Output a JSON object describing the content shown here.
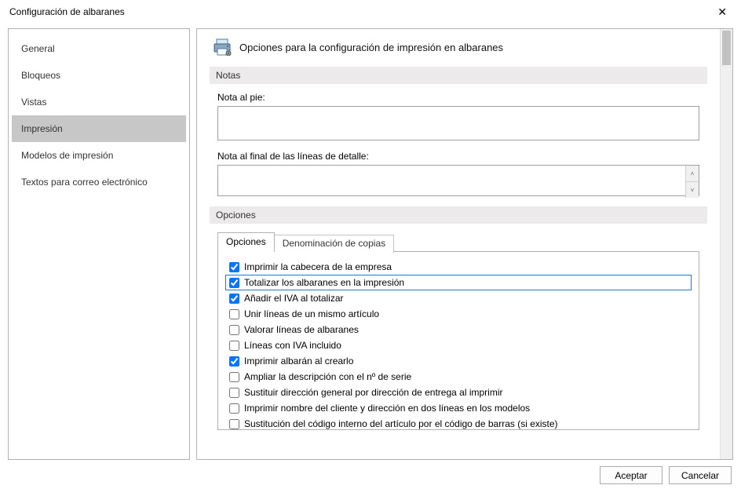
{
  "window": {
    "title": "Configuración de albaranes"
  },
  "sidebar": {
    "items": [
      {
        "label": "General"
      },
      {
        "label": "Bloqueos"
      },
      {
        "label": "Vistas"
      },
      {
        "label": "Impresión",
        "selected": true
      },
      {
        "label": "Modelos de impresión"
      },
      {
        "label": "Textos para correo electrónico"
      }
    ]
  },
  "page": {
    "heading": "Opciones para la configuración de impresión en albaranes",
    "section_notas": "Notas",
    "nota_pie_label": "Nota al pie:",
    "nota_pie_value": "",
    "nota_detalle_label": "Nota al final de las líneas de detalle:",
    "nota_detalle_value": "",
    "section_opciones": "Opciones",
    "tabs": {
      "active": "Opciones",
      "inactive": "Denominación de copias"
    },
    "checks": [
      {
        "label": "Imprimir la cabecera de la empresa",
        "checked": true,
        "hl": false
      },
      {
        "label": "Totalizar los albaranes en la impresión",
        "checked": true,
        "hl": true
      },
      {
        "label": "Añadir el IVA al totalizar",
        "checked": true,
        "hl": false
      },
      {
        "label": "Unir líneas de un mismo artículo",
        "checked": false,
        "hl": false
      },
      {
        "label": "Valorar líneas de albaranes",
        "checked": false,
        "hl": false
      },
      {
        "label": "Líneas con IVA incluido",
        "checked": false,
        "hl": false
      },
      {
        "label": "Imprimir albarán al crearlo",
        "checked": true,
        "hl": false
      },
      {
        "label": "Ampliar la descripción con el nº de serie",
        "checked": false,
        "hl": false
      },
      {
        "label": "Sustituir dirección general por dirección de entrega al imprimir",
        "checked": false,
        "hl": false
      },
      {
        "label": "Imprimir nombre del cliente y dirección en dos líneas en los modelos",
        "checked": false,
        "hl": false
      },
      {
        "label": "Sustitución del código interno del artículo por el código de barras (si existe)",
        "checked": false,
        "hl": false
      }
    ]
  },
  "buttons": {
    "ok": "Aceptar",
    "cancel": "Cancelar"
  }
}
